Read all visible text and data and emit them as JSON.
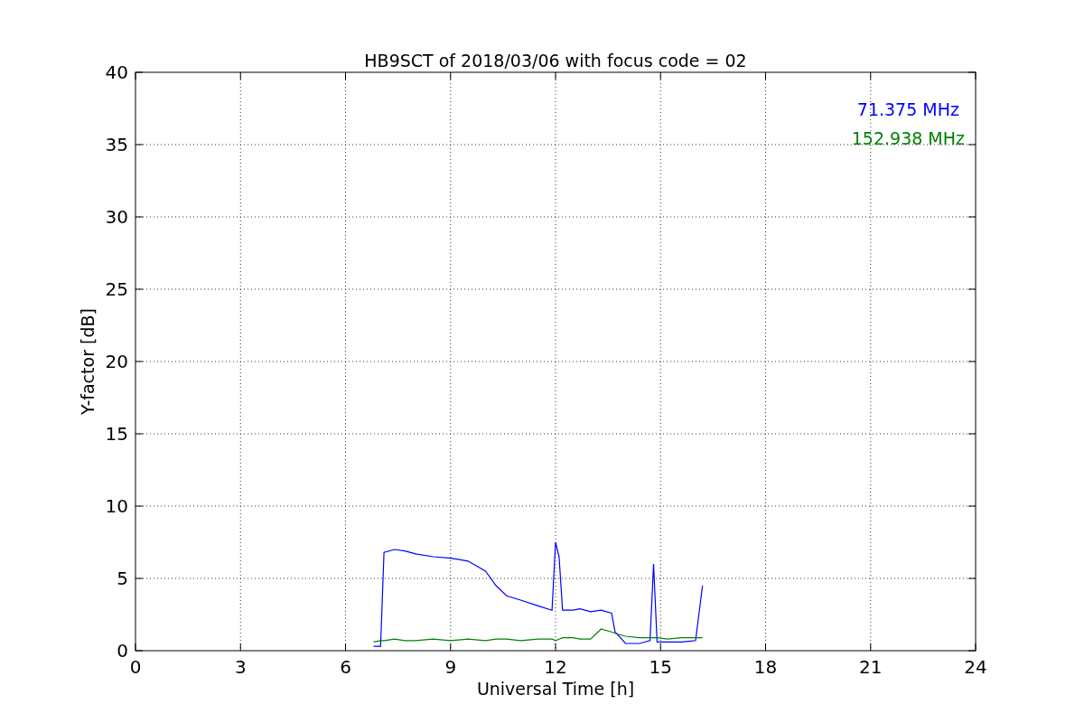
{
  "chart_data": {
    "type": "line",
    "title": "HB9SCT of 2018/03/06 with focus code = 02",
    "xlabel": "Universal Time [h]",
    "ylabel": "Y-factor [dB]",
    "x": [
      6.8,
      7.0,
      7.1,
      7.4,
      7.7,
      8.0,
      8.5,
      9.0,
      9.5,
      10.0,
      10.3,
      10.6,
      11.0,
      11.5,
      11.9,
      12.0,
      12.1,
      12.2,
      12.5,
      12.7,
      13.0,
      13.3,
      13.6,
      13.7,
      14.0,
      14.4,
      14.7,
      14.8,
      14.9,
      15.2,
      15.6,
      16.0,
      16.2
    ],
    "series": [
      {
        "name": "71.375 MHz",
        "color": "#0000ff",
        "values": [
          0.3,
          0.3,
          6.8,
          7.0,
          6.9,
          6.7,
          6.5,
          6.4,
          6.2,
          5.5,
          4.5,
          3.8,
          3.5,
          3.1,
          2.8,
          7.5,
          6.5,
          2.8,
          2.8,
          2.9,
          2.7,
          2.8,
          2.6,
          1.3,
          0.5,
          0.5,
          0.7,
          6.0,
          0.6,
          0.6,
          0.6,
          0.7,
          4.5
        ]
      },
      {
        "name": "152.938 MHz",
        "color": "#008000",
        "values": [
          0.6,
          0.7,
          0.7,
          0.8,
          0.7,
          0.7,
          0.8,
          0.7,
          0.8,
          0.7,
          0.8,
          0.8,
          0.7,
          0.8,
          0.8,
          0.7,
          0.8,
          0.9,
          0.9,
          0.8,
          0.8,
          1.5,
          1.3,
          1.2,
          1.0,
          0.9,
          0.9,
          0.9,
          0.9,
          0.8,
          0.9,
          0.9,
          0.9
        ]
      }
    ],
    "xlim": [
      0,
      24
    ],
    "ylim": [
      0,
      40
    ],
    "xticks": [
      0,
      3,
      6,
      9,
      12,
      15,
      18,
      21,
      24
    ],
    "yticks": [
      0,
      5,
      10,
      15,
      20,
      25,
      30,
      35,
      40
    ],
    "grid": true
  }
}
